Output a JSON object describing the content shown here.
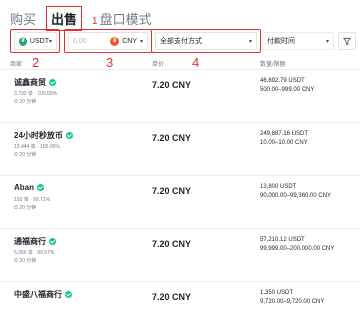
{
  "tabs": {
    "buy": "购买",
    "sell": "出售",
    "block": "盘口模式"
  },
  "annotations": {
    "a1": "1",
    "a2": "2",
    "a3": "3",
    "a4": "4"
  },
  "filters": {
    "asset": "USDT",
    "amount_placeholder": "0.00",
    "currency": "CNY",
    "payment": "全部支付方式",
    "time": "付款时间"
  },
  "header": {
    "advertiser": "商家",
    "price": "单价",
    "amount": "数量/限额"
  },
  "rows": [
    {
      "name": "诚鑫商贸",
      "stats": "3,793 单 · 100.00%",
      "time": "20 分钟",
      "price": "7.20 CNY",
      "amount": "46,892.79 USDT",
      "limit": "500.00–999.00 CNY"
    },
    {
      "name": "24小时秒放币",
      "stats": "13,444 单 · 100.00%",
      "time": "20 分钟",
      "price": "7.20 CNY",
      "amount": "249,887.16 USDT",
      "limit": "10.00–10.00 CNY"
    },
    {
      "name": "Aban",
      "stats": "193 单 · 99.71%",
      "time": "20 分钟",
      "price": "7.20 CNY",
      "amount": "13,800 USDT",
      "limit": "90,000.00–99,360.00 CNY"
    },
    {
      "name": "通福商行",
      "stats": "5,359 单 · 99.57%",
      "time": "20 分钟",
      "price": "7.20 CNY",
      "amount": "57,210.12 USDT",
      "limit": "99,999.00–200,000.00 CNY"
    },
    {
      "name": "中盛八福商行",
      "stats": "",
      "time": "",
      "price": "7.20 CNY",
      "amount": "1,350 USDT",
      "limit": "9,720.00–9,720.00 CNY"
    }
  ],
  "colors": {
    "accent": "#e03131",
    "green": "#0ecb81",
    "tether": "#26a17b",
    "cny": "#f05a28"
  }
}
